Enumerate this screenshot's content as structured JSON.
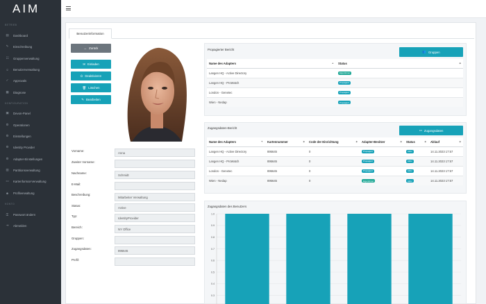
{
  "app": {
    "logo": "AIM"
  },
  "sidebar": {
    "sections": [
      {
        "label": "BETRIEB"
      },
      {
        "label": "KONFIGURATION"
      },
      {
        "label": "KONTO"
      }
    ],
    "items": [
      {
        "label": "Dashboard",
        "icon": "dashboard-icon"
      },
      {
        "label": "Einschreibung",
        "icon": "enrollment-icon"
      },
      {
        "label": "Gruppenverwaltung",
        "icon": "group-icon"
      },
      {
        "label": "Benutzerverwaltung",
        "icon": "user-icon"
      },
      {
        "label": "Approvals",
        "icon": "approval-icon"
      },
      {
        "label": "Diagnose",
        "icon": "diagnose-icon"
      },
      {
        "label": "Devon-Panel",
        "icon": "panel-icon"
      },
      {
        "label": "Operationen",
        "icon": "operations-icon"
      },
      {
        "label": "Einstellungen",
        "icon": "settings-icon"
      },
      {
        "label": "Identity Provider",
        "icon": "identity-icon"
      },
      {
        "label": "Adapter-Einstellungen",
        "icon": "adapter-icon"
      },
      {
        "label": "Partitionsverwaltung",
        "icon": "partition-icon"
      },
      {
        "label": "Kartenformat-Verwaltung",
        "icon": "card-format-icon"
      },
      {
        "label": "Profilverwaltung",
        "icon": "profile-icon"
      },
      {
        "label": "Passwort ändern",
        "icon": "password-icon"
      },
      {
        "label": "Abmelden",
        "icon": "logout-icon"
      }
    ]
  },
  "tab": {
    "label": "Benutzerinformation"
  },
  "buttons": {
    "back": "Zurück",
    "invite": "Einladen",
    "deactivate": "Deaktivieren",
    "delete": "Löschen",
    "edit": "Bearbeiten",
    "groups": "Gruppen",
    "access_data": "Zugangsdaten"
  },
  "form": [
    {
      "label": "Vorname:",
      "value": "Anna"
    },
    {
      "label": "Zweiter Vorname:",
      "value": ""
    },
    {
      "label": "Nachname:",
      "value": "Schmidt"
    },
    {
      "label": "E-Mail:",
      "value": ""
    },
    {
      "label": "Beschreibung:",
      "value": "Mitarbeiter Verwaltung"
    },
    {
      "label": "Status:",
      "value": "Active"
    },
    {
      "label": "Typ:",
      "value": "IdentityProvider"
    },
    {
      "label": "Bereich:",
      "value": "NY Office"
    },
    {
      "label": "Gruppen:",
      "value": ""
    },
    {
      "label": "Zugangsdaten:",
      "value": "895645"
    },
    {
      "label": "Profil:",
      "value": ""
    }
  ],
  "propagated": {
    "title": "Propagierter Bericht",
    "headers": [
      "Name des Adapters",
      "Status"
    ],
    "rows": [
      [
        "Langen HQ - Active Directory",
        "Eigentümer"
      ],
      [
        "Langen HQ - ProWatch",
        "Propagiert"
      ],
      [
        "London - Genetec",
        "Propagiert"
      ],
      [
        "Wien - Nedap",
        "Propagiert"
      ]
    ]
  },
  "access_report": {
    "title": "Zugangsdaten-Bericht",
    "headers": [
      "Name des Adapters",
      "Kartennummer",
      "Code der Einrichtung",
      "Adapter-Besitzer",
      "Status",
      "Ablauf"
    ],
    "rows": [
      [
        "Langen HQ - Active Directory",
        "895645",
        "0",
        "Propagiert",
        "Aktiv",
        "14.11.2023 17:57"
      ],
      [
        "Langen HQ - ProWatch",
        "895645",
        "0",
        "Propagiert",
        "Aktiv",
        "14.11.2023 17:57"
      ],
      [
        "London - Genetec",
        "895645",
        "0",
        "Propagiert",
        "Aktiv",
        "14.11.2023 17:57"
      ],
      [
        "Wien - Nedap",
        "895645",
        "0",
        "Eigentümer",
        "Aktiv",
        "14.11.2023 17:57"
      ]
    ]
  },
  "chart_data": {
    "type": "bar",
    "title": "Zugangsdaten des Benutzers",
    "categories": [
      "",
      "",
      "",
      ""
    ],
    "values": [
      1.0,
      1.0,
      1.0,
      1.0
    ],
    "ylim": [
      0.3,
      1.0
    ],
    "yticks": [
      "1.0",
      "0.9",
      "0.8",
      "0.7",
      "0.6",
      "0.5",
      "0.4",
      "0.3"
    ],
    "color": "#17a2b8",
    "grid": true
  }
}
